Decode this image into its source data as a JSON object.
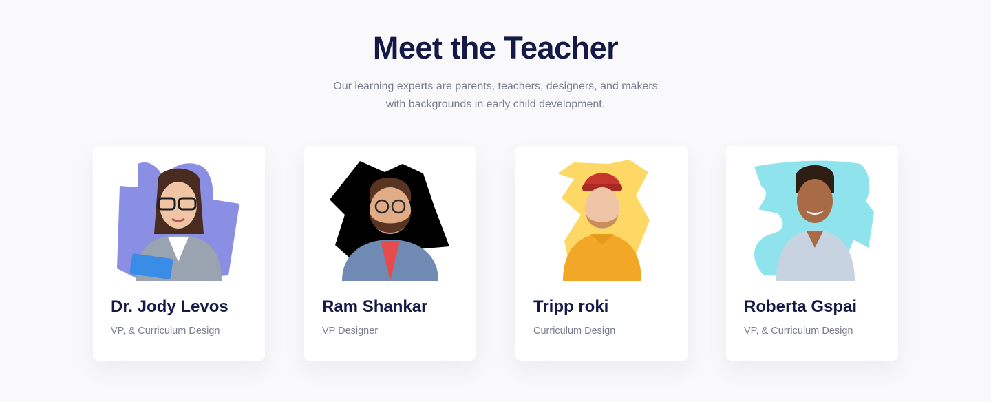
{
  "section": {
    "title": "Meet the Teacher",
    "subtitle_line1": "Our learning experts are parents, teachers, designers, and makers",
    "subtitle_line2": "with backgrounds in early child development."
  },
  "teachers": [
    {
      "name": "Dr. Jody Levos",
      "role": "VP, & Curriculum Design",
      "blob_color": "#8b8fe3",
      "photo_icon": "woman-with-glasses-portrait"
    },
    {
      "name": "Ram Shankar",
      "role": "VP Designer",
      "blob_color": "#000000",
      "photo_icon": "bearded-man-portrait"
    },
    {
      "name": "Tripp roki",
      "role": "Curriculum Design",
      "blob_color": "#fdd864",
      "photo_icon": "man-in-beanie-portrait"
    },
    {
      "name": "Roberta Gspai",
      "role": "VP, & Curriculum Design",
      "blob_color": "#8fe3ec",
      "photo_icon": "smiling-man-portrait"
    }
  ]
}
